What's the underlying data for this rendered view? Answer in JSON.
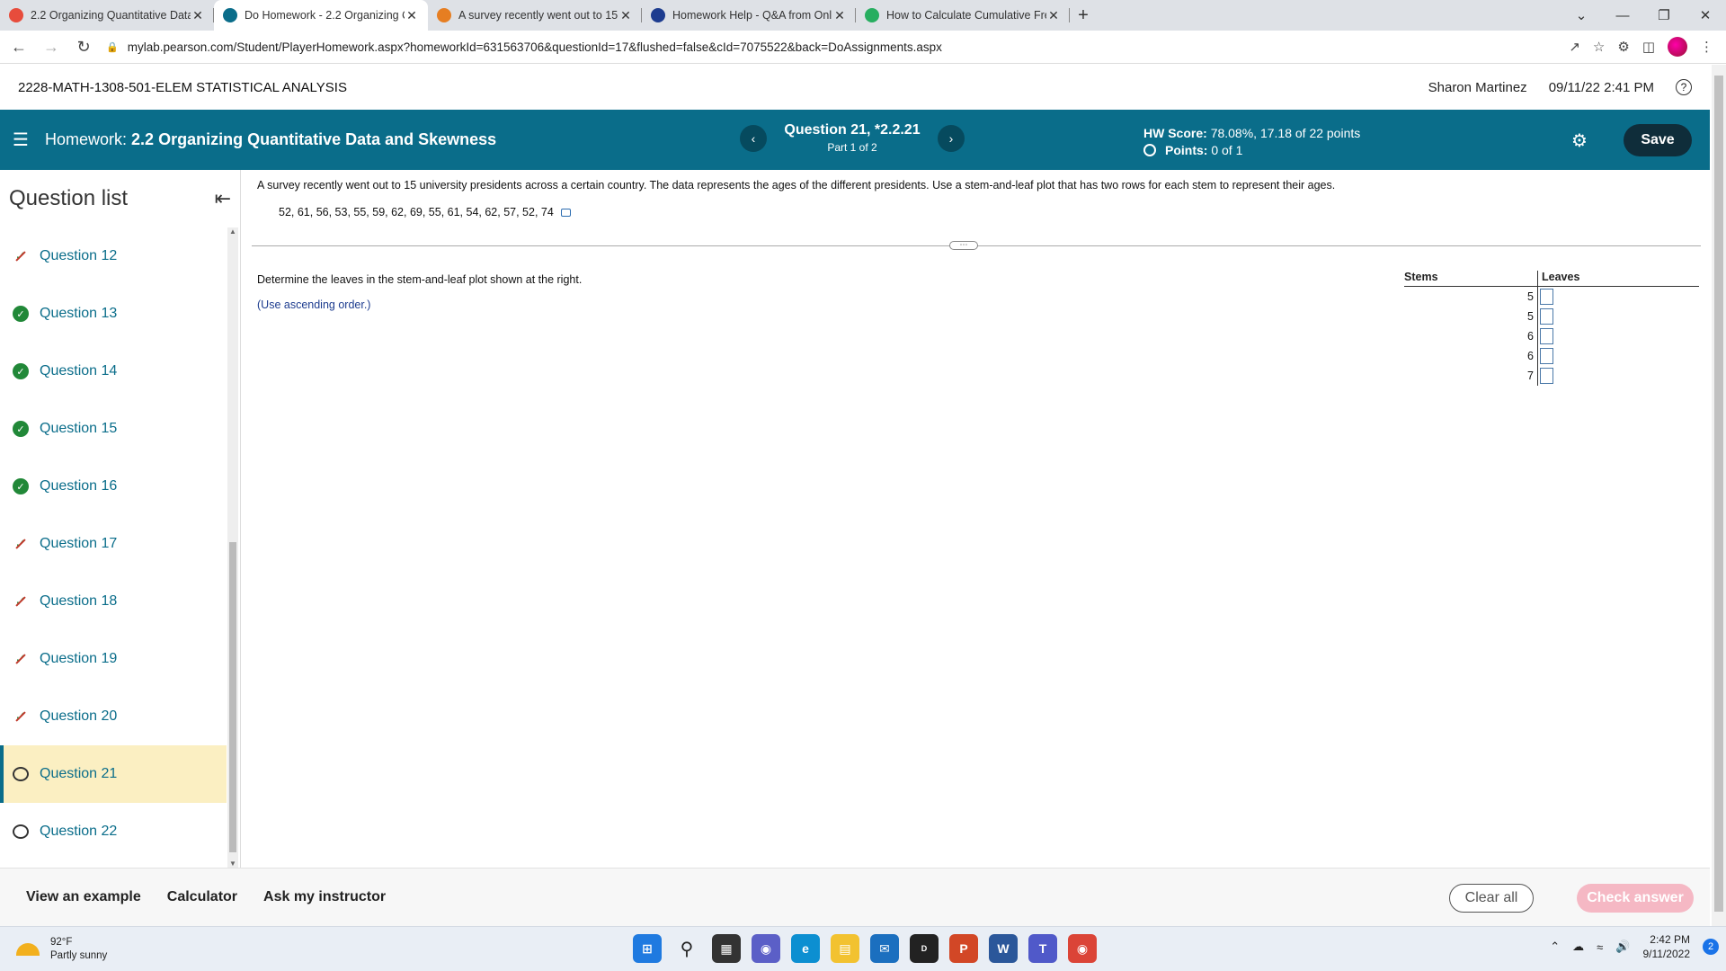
{
  "browser": {
    "tabs": [
      {
        "title": "2.2 Organizing Quantitative Data",
        "active": false,
        "icon_color": "#e74c3c"
      },
      {
        "title": "Do Homework - 2.2 Organizing Q",
        "active": true,
        "icon_color": "#0a6d8a"
      },
      {
        "title": "A survey recently went out to 15",
        "active": false,
        "icon_color": "#e67e22"
      },
      {
        "title": "Homework Help - Q&A from Onl",
        "active": false,
        "icon_color": "#1d3c8f"
      },
      {
        "title": "How to Calculate Cumulative Fre",
        "active": false,
        "icon_color": "#27ae60"
      }
    ],
    "new_tab": "+",
    "url": "mylab.pearson.com/Student/PlayerHomework.aspx?homeworkId=631563706&questionId=17&flushed=false&cId=7075522&back=DoAssignments.aspx"
  },
  "course": {
    "title": "2228-MATH-1308-501-ELEM STATISTICAL ANALYSIS",
    "user": "Sharon Martinez",
    "datetime": "09/11/22 2:41 PM",
    "help": "?"
  },
  "banner": {
    "hw_prefix": "Homework:",
    "hw_name": "2.2 Organizing Quantitative Data and Skewness",
    "question": "Question 21, *2.2.21",
    "part": "Part 1 of 2",
    "score_label": "HW Score:",
    "score_value": "78.08%, 17.18 of 22 points",
    "points_label": "Points:",
    "points_value": "0 of 1",
    "save": "Save",
    "colors": {
      "banner": "#0a6d8a",
      "save": "#0f2d3a"
    }
  },
  "sidebar": {
    "title": "Question list",
    "items": [
      {
        "label": "Question 12",
        "status": "partial"
      },
      {
        "label": "Question 13",
        "status": "correct"
      },
      {
        "label": "Question 14",
        "status": "correct"
      },
      {
        "label": "Question 15",
        "status": "correct"
      },
      {
        "label": "Question 16",
        "status": "correct"
      },
      {
        "label": "Question 17",
        "status": "partial"
      },
      {
        "label": "Question 18",
        "status": "partial"
      },
      {
        "label": "Question 19",
        "status": "partial"
      },
      {
        "label": "Question 20",
        "status": "partial"
      },
      {
        "label": "Question 21",
        "status": "open",
        "current": true
      },
      {
        "label": "Question 22",
        "status": "open"
      }
    ]
  },
  "problem": {
    "text": "A survey recently went out to 15 university presidents across a certain country. The data represents the ages of the different presidents. Use a stem-and-leaf plot that has two rows for each stem to represent their ages.",
    "data": "52, 61, 56, 53, 55, 59, 62, 69, 55, 61, 54, 62, 57, 52, 74",
    "instruction": "Determine the leaves in the stem-and-leaf plot shown at the right.",
    "hint": "(Use ascending order.)",
    "stem_header": "Stems",
    "leaf_header": "Leaves",
    "stems": [
      "5",
      "5",
      "6",
      "6",
      "7"
    ]
  },
  "footer": {
    "view_example": "View an example",
    "calculator": "Calculator",
    "ask": "Ask my instructor",
    "clear": "Clear all",
    "check": "Check answer"
  },
  "taskbar": {
    "temp": "92°F",
    "weather": "Partly sunny",
    "time": "2:42 PM",
    "date": "9/11/2022",
    "notifications": "2"
  }
}
